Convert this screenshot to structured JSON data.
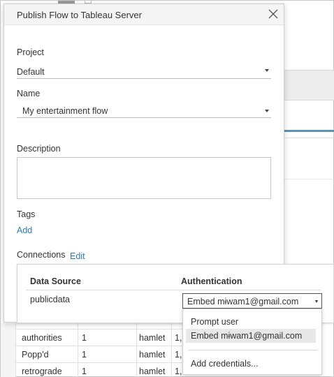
{
  "dialog": {
    "title": "Publish Flow to Tableau Server",
    "project": {
      "label": "Project",
      "value": "Default"
    },
    "name": {
      "label": "Name",
      "value": "My entertainment flow"
    },
    "description": {
      "label": "Description",
      "value": ""
    },
    "tags": {
      "label": "Tags",
      "add_link": "Add"
    },
    "connections": {
      "label": "Connections",
      "edit_link": "Edit"
    }
  },
  "connections_table": {
    "headers": {
      "data_source": "Data Source",
      "authentication": "Authentication"
    },
    "rows": [
      {
        "data_source": "publicdata",
        "authentication": "Embed mɨwam1@gmail.com"
      }
    ]
  },
  "auth_menu": {
    "items": [
      "Prompt user",
      "Embed mɨwam1@gmail.com"
    ],
    "selected_index": 1,
    "footer_item": "Add credentials..."
  },
  "background_table": {
    "rows": [
      {
        "word": "authorities",
        "count": "1",
        "play": "hamlet",
        "extra": "1,"
      },
      {
        "word": "Popp'd",
        "count": "1",
        "play": "hamlet",
        "extra": "1,"
      },
      {
        "word": "retrograde",
        "count": "1",
        "play": "hamlet",
        "extra": "1,"
      }
    ]
  },
  "colors": {
    "link": "#2a7ab8",
    "accent_line": "#5f91b5"
  },
  "icons": {
    "close": "close-icon",
    "dropdown": "chevron-down-icon"
  }
}
